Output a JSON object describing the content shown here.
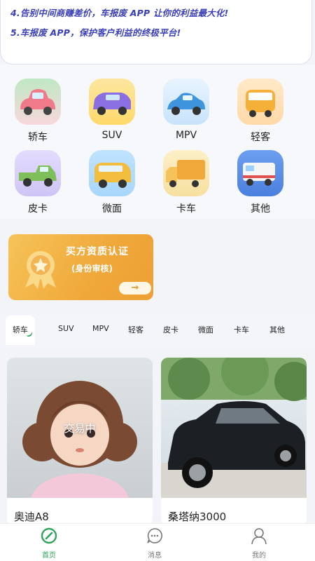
{
  "notice": {
    "line4": "4.告别中间商赚差价，车报废 APP 让你的利益最大化!",
    "line5": "5.车报废 APP，保护客户利益的终极平台!"
  },
  "categories": [
    {
      "label": "轿车",
      "icon": "sedan-icon",
      "color": "#f2828f"
    },
    {
      "label": "SUV",
      "icon": "suv-icon",
      "color": "#7f6fd8"
    },
    {
      "label": "MPV",
      "icon": "mpv-icon",
      "color": "#5aa9e8"
    },
    {
      "label": "轻客",
      "icon": "light-bus-icon",
      "color": "#f4b24a"
    },
    {
      "label": "皮卡",
      "icon": "pickup-icon",
      "color": "#7fc86a"
    },
    {
      "label": "微面",
      "icon": "minivan-icon",
      "color": "#f2c14e"
    },
    {
      "label": "卡车",
      "icon": "truck-icon",
      "color": "#f0b24c"
    },
    {
      "label": "其他",
      "icon": "rv-icon",
      "color": "#5b8fe0"
    }
  ],
  "banner": {
    "title": "买方资质认证",
    "subtitle": "(身份审核)",
    "arrow": "→"
  },
  "tabs": [
    "轿车",
    "SUV",
    "MPV",
    "轻客",
    "皮卡",
    "微面",
    "卡车",
    "其他"
  ],
  "listings": [
    {
      "name": "奥迪A8",
      "badge": "交易中"
    },
    {
      "name": "桑塔纳3000",
      "badge": ""
    }
  ],
  "nav": [
    {
      "label": "首页",
      "icon": "home-icon",
      "active": true
    },
    {
      "label": "消息",
      "icon": "message-icon",
      "active": false
    },
    {
      "label": "我的",
      "icon": "profile-icon",
      "active": false
    }
  ],
  "colors": {
    "accent": "#2fa45a",
    "notice_text": "#3a3fb8",
    "banner": "#f0a83a"
  }
}
